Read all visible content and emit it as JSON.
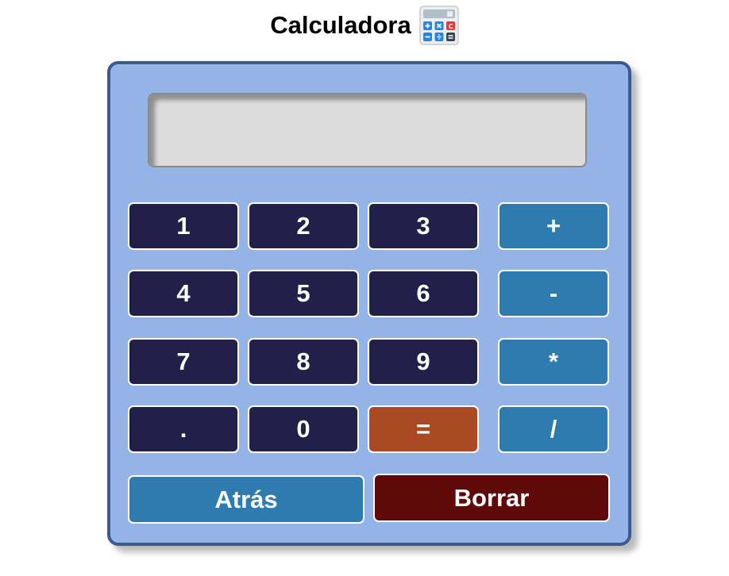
{
  "header": {
    "title": "Calculadora",
    "icon": "calculator-icon"
  },
  "display": {
    "value": ""
  },
  "keypad": {
    "k1": "1",
    "k2": "2",
    "k3": "3",
    "plus": "+",
    "k4": "4",
    "k5": "5",
    "k6": "6",
    "minus": "-",
    "k7": "7",
    "k8": "8",
    "k9": "9",
    "multiply": "*",
    "dot": ".",
    "k0": "0",
    "equals": "=",
    "divide": "/"
  },
  "actions": {
    "back_label": "Atrás",
    "clear_label": "Borrar"
  },
  "colors": {
    "calculator_bg": "#94b3e6",
    "calculator_border": "#3a5a92",
    "number_key": "#22204a",
    "operator_key": "#2e7bb0",
    "equals_key": "#a94a25",
    "clear_key": "#5f0909",
    "display_bg": "#dcdcdc"
  }
}
